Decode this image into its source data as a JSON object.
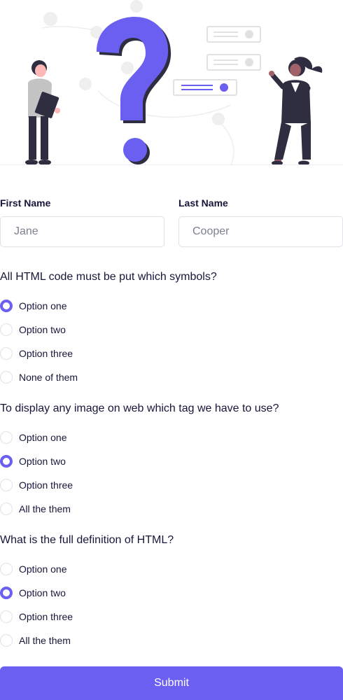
{
  "form": {
    "first_name": {
      "label": "First Name",
      "value": "Jane"
    },
    "last_name": {
      "label": "Last Name",
      "value": "Cooper"
    }
  },
  "questions": [
    {
      "title": "All HTML code must be put which symbols?",
      "options": [
        "Option one",
        "Option two",
        "Option three",
        "None of them"
      ],
      "selected_index": 0
    },
    {
      "title": "To display any image on web which tag we have to use?",
      "options": [
        "Option one",
        "Option two",
        "Option three",
        "All the them"
      ],
      "selected_index": 1
    },
    {
      "title": "What is the full definition of HTML?",
      "options": [
        "Option one",
        "Option two",
        "Option three",
        "All the them"
      ],
      "selected_index": 1
    }
  ],
  "submit_label": "Submit",
  "colors": {
    "accent": "#6a5ff0",
    "text": "#16163a",
    "border": "#dfe2e8"
  }
}
